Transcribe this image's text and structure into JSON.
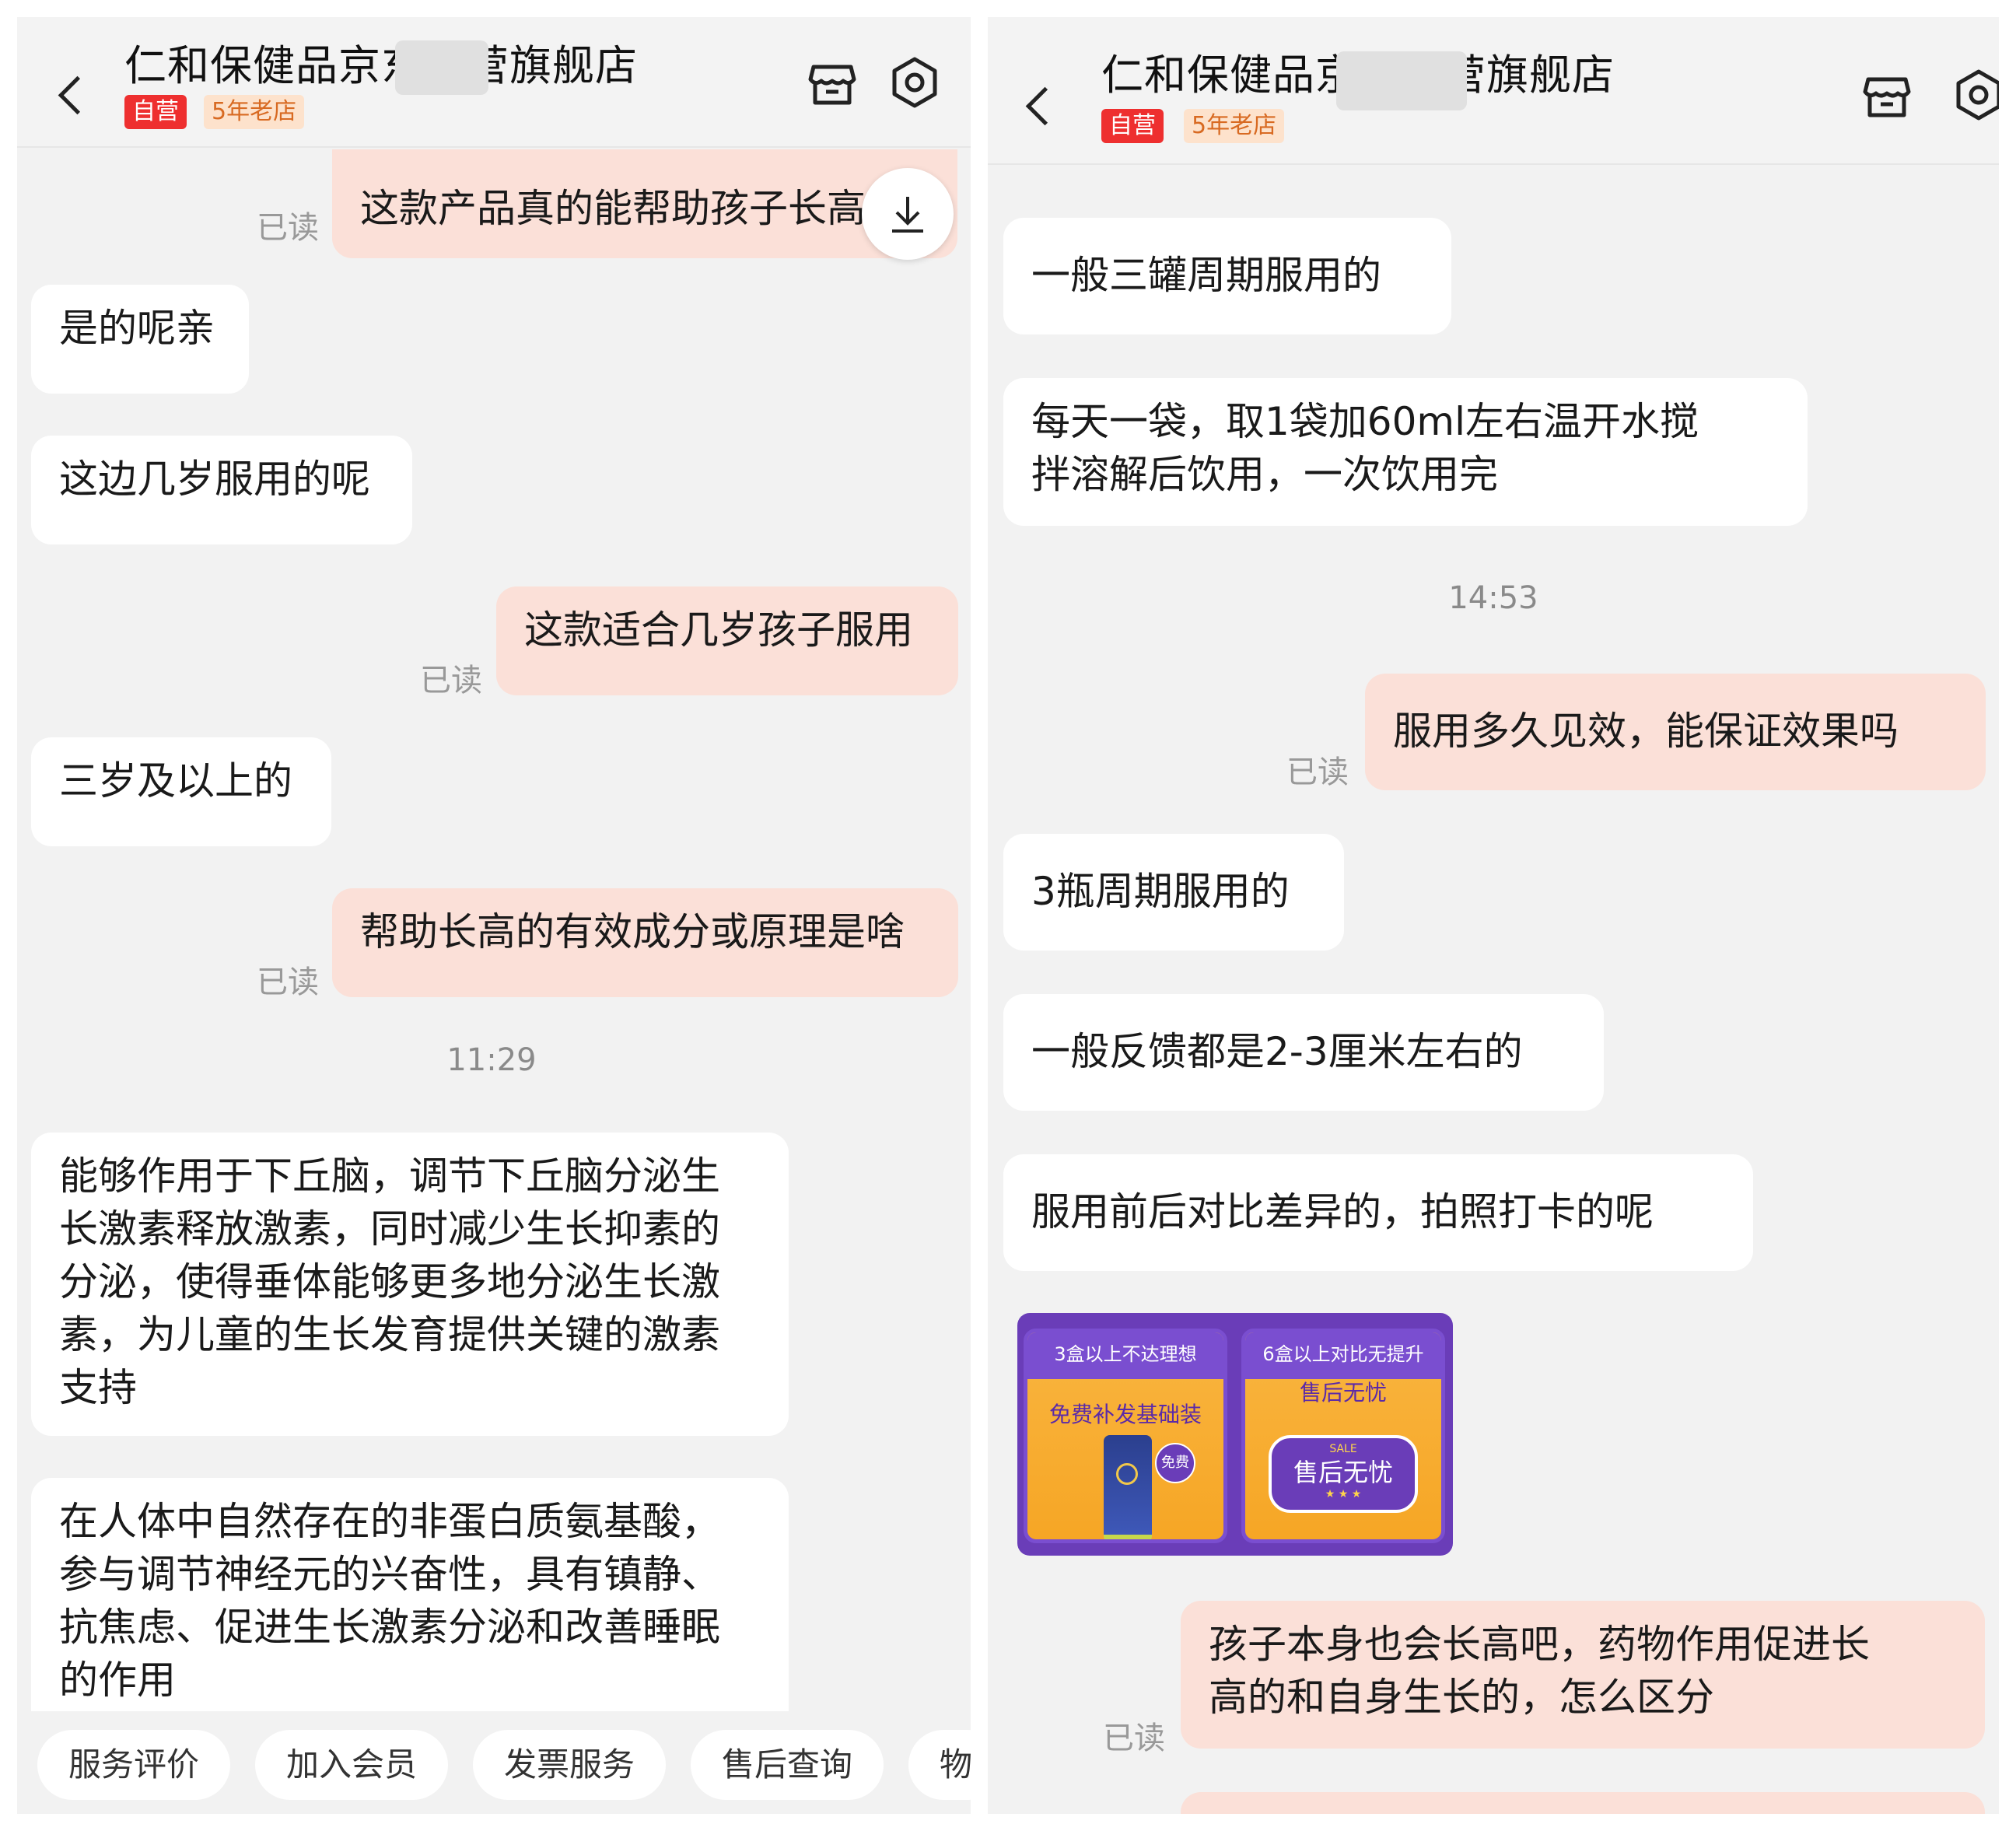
{
  "left": {
    "header": {
      "shop_name": "仁和保健品京东自营旗舰店",
      "badge_self": "自营",
      "badge_years": "5年老店"
    },
    "messages": {
      "m0": "这款产品真的能帮助孩子长高",
      "m1": "是的呢亲",
      "m2": "这边几岁服用的呢",
      "m3": "这款适合几岁孩子服用",
      "m4": "三岁及以上的",
      "m5": "帮助长高的有效成分或原理是啥",
      "m6": "能够作用于下丘脑，调节下丘脑分泌生\n长激素释放激素，同时减少生长抑素的\n分泌，使得垂体能够更多地分泌生长激\n素，为儿童的生长发育提供关键的激素\n支持",
      "m7": "在人体中自然存在的非蛋白质氨基酸，\n参与调节神经元的兴奋性，具有镇静、\n抗焦虑、促进生长激素分泌和改善睡眠\n的作用"
    },
    "read_label": "已读",
    "time": "11:29",
    "quick_actions": [
      "服务评价",
      "加入会员",
      "发票服务",
      "售后查询",
      "物"
    ]
  },
  "right": {
    "header": {
      "shop_name": "仁和保健品京东自营旗舰店",
      "badge_self": "自营",
      "badge_years": "5年老店"
    },
    "messages": {
      "m0": "一般三罐周期服用的",
      "m1": "每天一袋，取1袋加60ml左右温开水搅\n拌溶解后饮用，一次饮用完",
      "m2": "服用多久见效，能保证效果吗",
      "m3": "3瓶周期服用的",
      "m4": "一般反馈都是2-3厘米左右的",
      "m5": "服用前后对比差异的，拍照打卡的呢",
      "m6": "孩子本身也会长高吧，药物作用促进长\n高的和自身生长的，怎么区分"
    },
    "read_label": "已读",
    "time": "14:53",
    "promo": {
      "card1_title": "3盒以上不达理想",
      "card1_sub": "免费补发基础装",
      "card1_free": "免费",
      "card2_title": "6盒以上对比无提升",
      "card2_sub": "售后无忧",
      "card2_sale": "SALE",
      "card2_ribbon": "售后无忧",
      "card2_stars": "★ ★ ★"
    }
  },
  "colors": {
    "bubble_out": "#fbe0d8",
    "bubble_in": "#ffffff",
    "badge_red": "#ee2f2f",
    "badge_orange_bg": "#fde2cc"
  }
}
